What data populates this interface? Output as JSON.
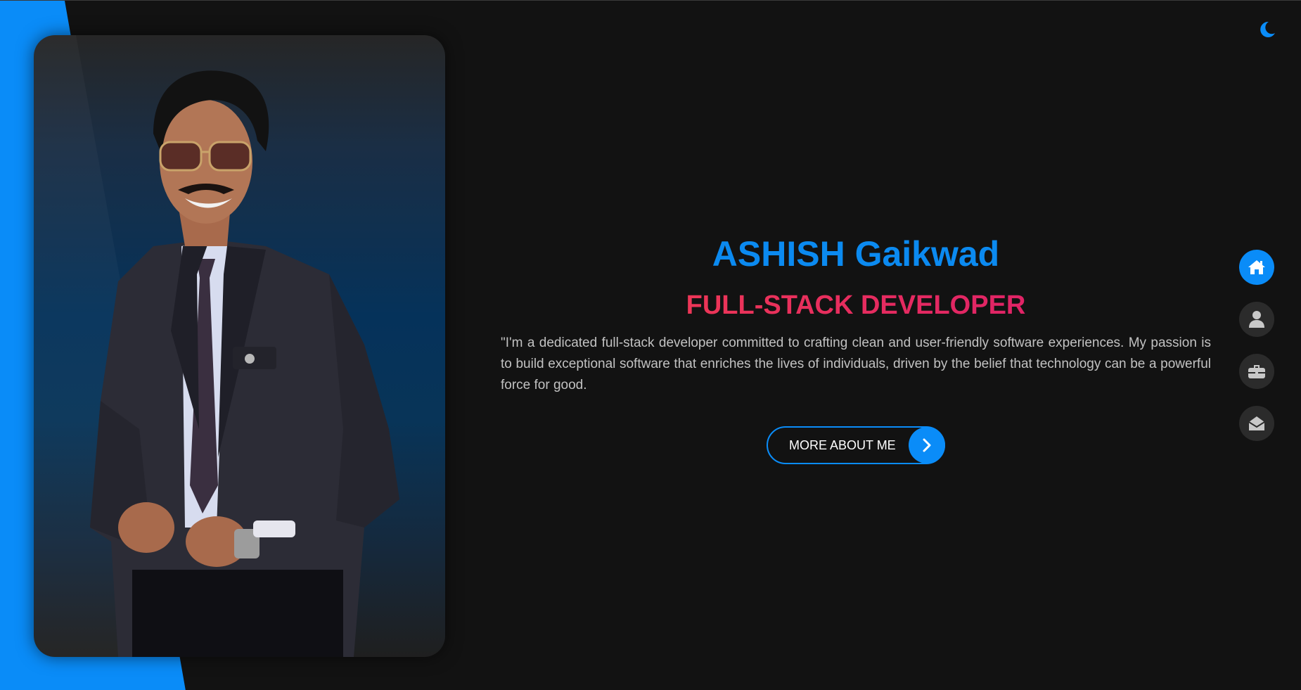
{
  "hero": {
    "name": "ASHISH Gaikwad",
    "role": "FULL-STACK DEVELOPER",
    "bio": "\"I'm a dedicated full-stack developer committed to crafting clean and user-friendly software experiences. My passion is to build exceptional software that enriches the lives of individuals, driven by the belief that technology can be a powerful force for good.",
    "cta_label": "MORE ABOUT ME"
  },
  "icons": {
    "theme_toggle": "moon-icon",
    "cta_arrow": "chevron-right-icon",
    "nav": [
      "home-icon",
      "user-icon",
      "briefcase-icon",
      "envelope-open-icon"
    ]
  },
  "nav": {
    "active_index": 0
  },
  "colors": {
    "accent": "#0a8cf8",
    "background": "#121212",
    "role_gradient_start": "#f4404f",
    "role_gradient_end": "#d8196e",
    "text_muted": "#c2c2c2",
    "nav_inactive": "#2b2b2b"
  }
}
